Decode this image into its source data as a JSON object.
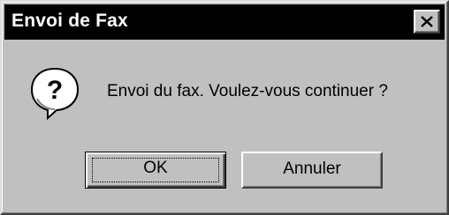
{
  "dialog": {
    "title": "Envoi de Fax",
    "message": "Envoi du fax. Voulez-vous continuer ?",
    "icon": "question-icon"
  },
  "buttons": {
    "ok_label": "OK",
    "cancel_label": "Annuler"
  },
  "colors": {
    "face": "#c0c0c0",
    "titlebar": "#000000",
    "title_text": "#ffffff"
  }
}
